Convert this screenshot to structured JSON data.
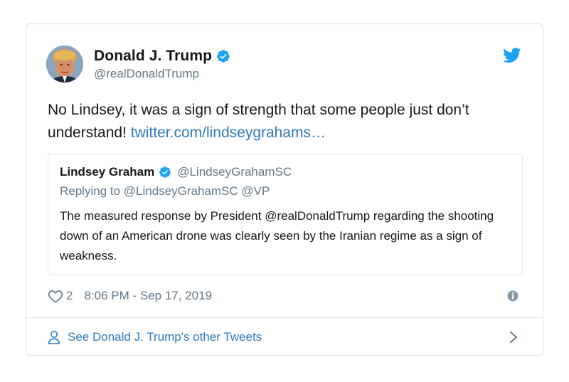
{
  "author": {
    "display_name": "Donald J. Trump",
    "handle": "@realDonaldTrump",
    "verified": true
  },
  "tweet": {
    "text": "No Lindsey, it was a sign of strength that some people just don’t understand!",
    "link_text": "twitter.com/lindseygrahams…"
  },
  "quoted_tweet": {
    "display_name": "Lindsey Graham",
    "handle": "@LindseyGrahamSC",
    "verified": true,
    "replying_to": "Replying to @LindseyGrahamSC @VP",
    "text": "The measured response by President @realDonaldTrump regarding the shooting down of an American drone was clearly seen by the Iranian regime as a sign of weakness."
  },
  "meta": {
    "like_count": "2",
    "timestamp": "8:06 PM - Sep 17, 2019"
  },
  "footer": {
    "label": "See Donald J. Trump's other Tweets"
  },
  "colors": {
    "link": "#2b7bb9",
    "verified": "#1da1f2",
    "secondary_text": "#657786",
    "border": "#e1e8ed"
  },
  "icons": [
    "avatar-photo",
    "verified-icon",
    "twitter-bird-icon",
    "heart-icon",
    "info-icon",
    "person-icon",
    "chevron-right-icon"
  ]
}
